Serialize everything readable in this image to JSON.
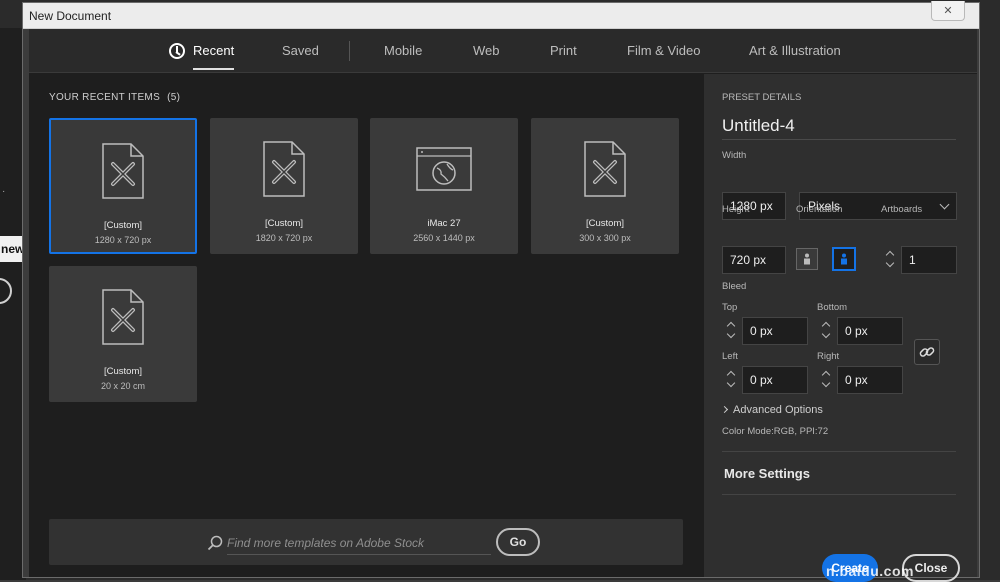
{
  "window": {
    "title": "New Document",
    "close_glyph": "✕"
  },
  "tabs": [
    {
      "label": "Recent",
      "active": true,
      "icon": "clock-icon"
    },
    {
      "label": "Saved"
    },
    {
      "label": "Mobile"
    },
    {
      "label": "Web"
    },
    {
      "label": "Print"
    },
    {
      "label": "Film & Video"
    },
    {
      "label": "Art & Illustration"
    }
  ],
  "recent": {
    "title": "YOUR RECENT ITEMS",
    "count": "(5)",
    "items": [
      {
        "name": "[Custom]",
        "dims": "1280 x 720 px",
        "icon": "custom-document-icon",
        "selected": true
      },
      {
        "name": "[Custom]",
        "dims": "1820 x 720 px",
        "icon": "custom-document-icon"
      },
      {
        "name": "iMac 27",
        "dims": "2560 x 1440 px",
        "icon": "web-browser-icon"
      },
      {
        "name": "[Custom]",
        "dims": "300 x 300 px",
        "icon": "custom-document-icon"
      },
      {
        "name": "[Custom]",
        "dims": "20 x 20 cm",
        "icon": "custom-document-icon"
      }
    ]
  },
  "search": {
    "placeholder": "Find more templates on Adobe Stock",
    "go_label": "Go"
  },
  "preset": {
    "header": "PRESET DETAILS",
    "name": "Untitled-4",
    "width_label": "Width",
    "width_value": "1280 px",
    "unit": "Pixels",
    "height_label": "Height",
    "height_value": "720 px",
    "orientation_label": "Orientation",
    "artboards_label": "Artboards",
    "artboards_value": "1",
    "bleed_label": "Bleed",
    "top_label": "Top",
    "top_value": "0 px",
    "bottom_label": "Bottom",
    "bottom_value": "0 px",
    "left_label": "Left",
    "left_value": "0 px",
    "right_label": "Right",
    "right_value": "0 px",
    "advanced_label": "Advanced Options",
    "color_mode": "Color Mode:RGB, PPI:72",
    "more_settings": "More Settings",
    "create_label": "Create",
    "close_label": "Close"
  },
  "background": {
    "partial_label": "new"
  },
  "watermark": "n.baidu.com",
  "colors": {
    "accent": "#1473e6",
    "panel": "#2f2f2f",
    "canvas": "#1e1e1e"
  }
}
